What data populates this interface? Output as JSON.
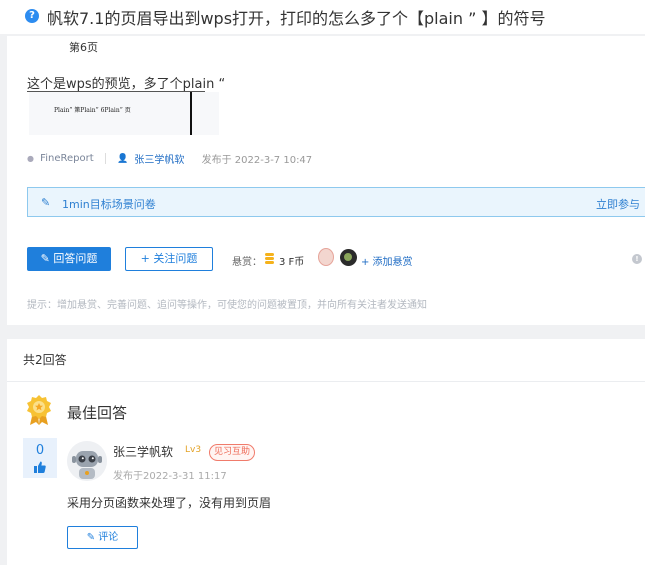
{
  "header": {
    "question_icon": "question-circle-icon",
    "title": "帆软7.1的页眉导出到wps打开，打印的怎么多了个【plain ” 】的符号"
  },
  "question": {
    "page_label": "第6页",
    "description": "这个是wps的预览，多了个plain “",
    "preview_text": "Plain” 第Plain” 6Plain” 页",
    "meta": {
      "tag": "FineReport",
      "author": "张三学帆软",
      "published": "发布于 2022-3-7 10:47"
    },
    "survey": {
      "text": "1min目标场景问卷",
      "link": "立即参与"
    },
    "actions": {
      "answer_label": "回答问题",
      "follow_label": "关注问题"
    },
    "reward": {
      "label": "悬赏：",
      "amount": "3 F币",
      "add_label": "+ 添加悬赏"
    },
    "hint": "提示：增加悬赏、完善问题、追问等操作，可使您的问题被置顶，并向所有关注者发送通知"
  },
  "answers": {
    "count_label": "共2回答",
    "best_title": "最佳回答",
    "best": {
      "votes": "0",
      "author": "张三学帆软",
      "level": "Lv3",
      "badge": "见习互助",
      "time": "发布于2022-3-31 11:17",
      "content": "采用分页函数来处理了，没有用到页眉",
      "comment_label": "评论"
    }
  },
  "colors": {
    "accent": "#1f7fdc",
    "link": "#1f6cc4",
    "badge": "#ee6a57",
    "level": "#e3a226"
  }
}
